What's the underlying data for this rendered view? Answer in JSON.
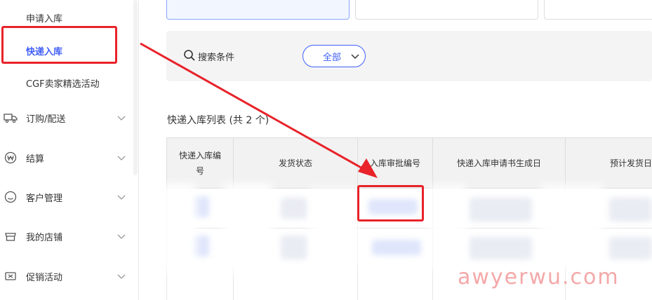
{
  "sidebar": {
    "sub_items": [
      {
        "label": "申请入库"
      },
      {
        "label": "快递入库"
      },
      {
        "label": "CGF卖家精选活动"
      }
    ],
    "items": [
      {
        "label": "订购/配送",
        "icon": "truck-icon"
      },
      {
        "label": "结算",
        "icon": "won-coin-icon"
      },
      {
        "label": "客户管理",
        "icon": "smiley-icon"
      },
      {
        "label": "我的店铺",
        "icon": "store-icon"
      },
      {
        "label": "促销活动",
        "icon": "ticket-icon"
      }
    ]
  },
  "filter": {
    "search_label": "搜索条件",
    "dropdown_value": "全部"
  },
  "list": {
    "title": "快递入库列表 (共 2 个)"
  },
  "table": {
    "headers": [
      "快递入库编号",
      "发货状态",
      "入库审批编号",
      "快递入库申请书生成日",
      "预计发货日"
    ]
  },
  "watermark": "awyerwu.com",
  "colors": {
    "accent": "#3f5ef8",
    "highlight": "#e8232a",
    "panel": "#f4f4f5",
    "header_bg": "#f2f2f2"
  }
}
